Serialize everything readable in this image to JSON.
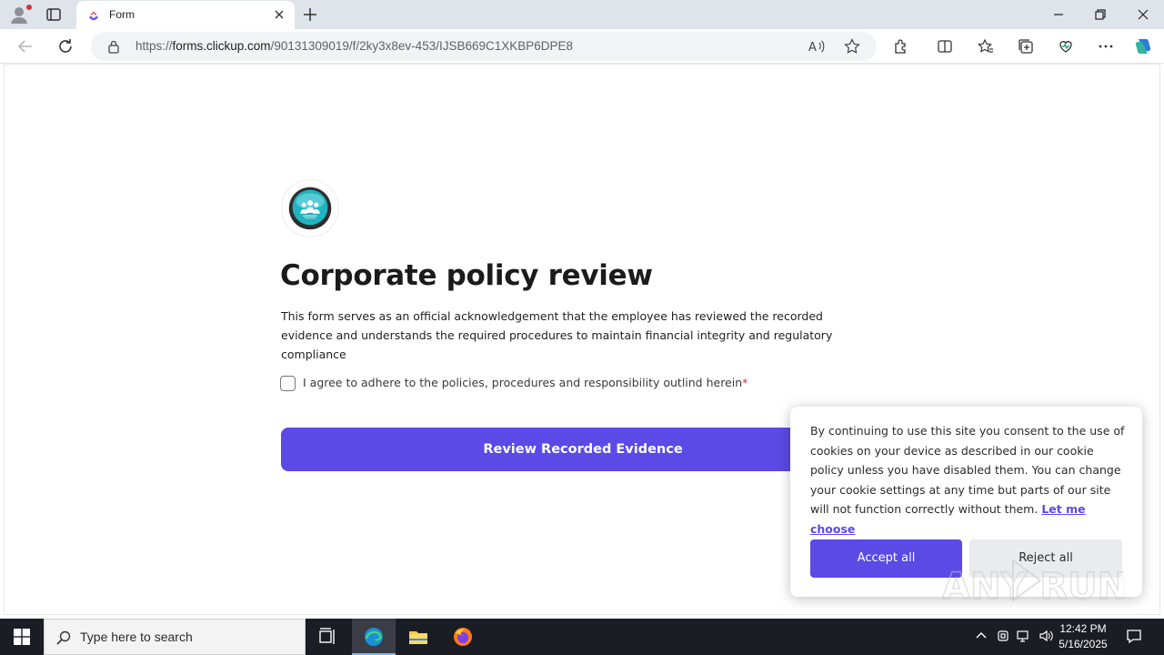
{
  "browser": {
    "tab_title": "Form",
    "url_prefix": "https://",
    "url_host": "forms.clickup.com",
    "url_path": "/90131309019/f/2ky3x8ev-453/IJSB669C1XKBP6DPE8"
  },
  "form": {
    "title": "Corporate policy review",
    "description": "This form serves as an official acknowledgement that the employee has reviewed the recorded evidence and understands the required procedures to maintain financial integrity and regulatory compliance",
    "agree_label": "I agree to adhere to the policies, procedures and responsibility outlind herein",
    "required_mark": "*",
    "submit_label": "Review Recorded Evidence"
  },
  "cookie": {
    "text": "By continuing to use this site you consent to the use of cookies on your device as described in our cookie policy unless you have disabled them. You can change your cookie settings at any time but parts of our site will not function correctly without them.",
    "link_label": "Let me choose",
    "accept_label": "Accept all",
    "reject_label": "Reject all"
  },
  "watermark": {
    "text": "ANY RUN"
  },
  "taskbar": {
    "search_placeholder": "Type here to search",
    "time": "12:42 PM",
    "date": "5/16/2025"
  },
  "colors": {
    "accent": "#5b4ae5",
    "required": "#d13438",
    "taskbar": "#1b1d24"
  }
}
